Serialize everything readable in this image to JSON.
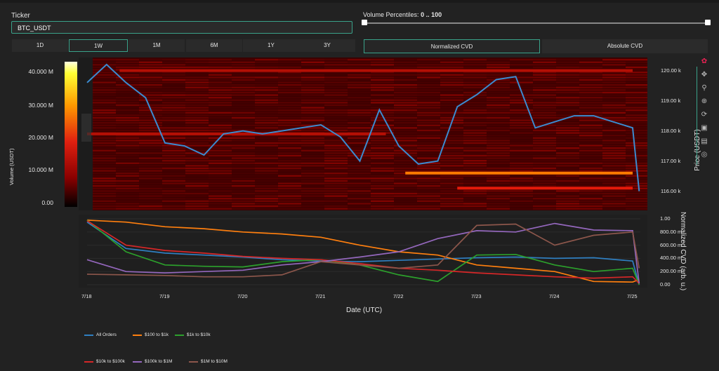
{
  "ticker": {
    "label": "Ticker",
    "value": "BTC_USDT"
  },
  "volume_percentiles": {
    "label": "Volume Percentiles:",
    "value": "0 .. 100",
    "range": [
      0,
      100
    ]
  },
  "timeframes": [
    {
      "label": "1D",
      "active": false
    },
    {
      "label": "1W",
      "active": true
    },
    {
      "label": "1M",
      "active": false
    },
    {
      "label": "6M",
      "active": false
    },
    {
      "label": "1Y",
      "active": false
    },
    {
      "label": "3Y",
      "active": false
    }
  ],
  "modes": {
    "normalized": "Normalized CVD",
    "absolute": "Absolute CVD",
    "active": "normalized"
  },
  "colorbar": {
    "title": "Volume (USDT)",
    "ticks": [
      "40.000 M",
      "30.000 M",
      "20.000 M",
      "10.000 M",
      "0.00"
    ]
  },
  "price_axis": {
    "title": "Price (USDT)",
    "ticks": [
      "120.00 k",
      "119.00 k",
      "118.00 k",
      "117.00 k",
      "116.00 k"
    ]
  },
  "cvd_axis": {
    "title": "Normalized CVD (arb. u.)",
    "ticks": [
      "1.00",
      "800.00 m",
      "600.00 m",
      "400.00 m",
      "200.00 m",
      "0.00"
    ]
  },
  "x_axis": {
    "title": "Date (UTC)",
    "ticks": [
      "7/18",
      "7/19",
      "7/20",
      "7/21",
      "7/22",
      "7/23",
      "7/24",
      "7/25"
    ]
  },
  "legend": [
    {
      "label": "All Orders",
      "color": "#2f7fc1"
    },
    {
      "label": "$100 to $1k",
      "color": "#ff7f0e"
    },
    {
      "label": "$1k to $10k",
      "color": "#2ca02c"
    },
    {
      "label": "$10k to $100k",
      "color": "#d62728"
    },
    {
      "label": "$100k to $1M",
      "color": "#9467bd"
    },
    {
      "label": "$1M to $10M",
      "color": "#8c564b"
    }
  ],
  "toolbar": [
    "plotly-logo-icon",
    "pan-icon",
    "zoom-icon",
    "zoom-in-icon",
    "reset-icon",
    "download-icon",
    "comment-icon",
    "autoscale-icon"
  ],
  "chart_data": [
    {
      "type": "heatmap",
      "title": "",
      "xlabel": "Date (UTC)",
      "ylabel": "Price (USDT)",
      "ylim": [
        115800,
        120400
      ],
      "heat_bands": [
        {
          "price": 120000,
          "start": "7/18 10:00",
          "end": "7/25 00:00",
          "volume_M": 9
        },
        {
          "price": 116600,
          "start": "7/22 02:00",
          "end": "7/25 00:00",
          "volume_M": 30
        },
        {
          "price": 116100,
          "start": "7/22 18:00",
          "end": "7/25 00:00",
          "volume_M": 14
        },
        {
          "price": 117900,
          "start": "7/18 00:00",
          "end": "7/21 20:00",
          "volume_M": 7
        }
      ],
      "price_line": {
        "name": "",
        "color": "#3b8bd0",
        "x": [
          "7/18 00:00",
          "7/18 06:00",
          "7/18 12:00",
          "7/18 18:00",
          "7/19 00:00",
          "7/19 06:00",
          "7/19 12:00",
          "7/19 18:00",
          "7/20 00:00",
          "7/20 06:00",
          "7/20 12:00",
          "7/20 18:00",
          "7/21 00:00",
          "7/21 06:00",
          "7/21 12:00",
          "7/21 18:00",
          "7/22 00:00",
          "7/22 06:00",
          "7/22 12:00",
          "7/22 18:00",
          "7/23 00:00",
          "7/23 06:00",
          "7/23 12:00",
          "7/23 18:00",
          "7/24 00:00",
          "7/24 06:00",
          "7/24 12:00",
          "7/24 18:00",
          "7/25 00:00",
          "7/25 02:00"
        ],
        "y": [
          119600,
          120200,
          119600,
          119100,
          117600,
          117500,
          117200,
          117900,
          118000,
          117900,
          118000,
          118100,
          118200,
          117800,
          117000,
          118700,
          117500,
          116900,
          117000,
          118800,
          119200,
          119700,
          119800,
          118100,
          118300,
          118500,
          118500,
          118300,
          118100,
          116000
        ]
      }
    },
    {
      "type": "line",
      "title": "",
      "xlabel": "Date (UTC)",
      "ylabel": "Normalized CVD (arb. u.)",
      "ylim": [
        0,
        1
      ],
      "x": [
        "7/18 00:00",
        "7/18 12:00",
        "7/19 00:00",
        "7/19 12:00",
        "7/20 00:00",
        "7/20 12:00",
        "7/21 00:00",
        "7/21 12:00",
        "7/22 00:00",
        "7/22 12:00",
        "7/23 00:00",
        "7/23 12:00",
        "7/24 00:00",
        "7/24 12:00",
        "7/25 00:00",
        "7/25 02:00"
      ],
      "series": [
        {
          "name": "All Orders",
          "color": "#2f7fc1",
          "values": [
            0.95,
            0.55,
            0.48,
            0.45,
            0.42,
            0.38,
            0.36,
            0.35,
            0.37,
            0.39,
            0.41,
            0.42,
            0.4,
            0.41,
            0.36,
            0.0
          ]
        },
        {
          "name": "$100 to $1k",
          "color": "#ff7f0e",
          "values": [
            0.98,
            0.95,
            0.88,
            0.85,
            0.8,
            0.77,
            0.72,
            0.6,
            0.5,
            0.45,
            0.3,
            0.25,
            0.2,
            0.05,
            0.04,
            0.08
          ]
        },
        {
          "name": "$1k to $10k",
          "color": "#2ca02c",
          "values": [
            0.98,
            0.5,
            0.3,
            0.28,
            0.27,
            0.35,
            0.38,
            0.3,
            0.15,
            0.05,
            0.45,
            0.46,
            0.3,
            0.2,
            0.25,
            0.0
          ]
        },
        {
          "name": "$10k to $100k",
          "color": "#d62728",
          "values": [
            0.97,
            0.6,
            0.52,
            0.48,
            0.43,
            0.4,
            0.38,
            0.32,
            0.25,
            0.22,
            0.18,
            0.15,
            0.12,
            0.1,
            0.12,
            0.02
          ]
        },
        {
          "name": "$100k to $1M",
          "color": "#9467bd",
          "values": [
            0.38,
            0.2,
            0.18,
            0.2,
            0.22,
            0.3,
            0.35,
            0.42,
            0.5,
            0.7,
            0.82,
            0.8,
            0.93,
            0.83,
            0.82,
            0.02
          ]
        },
        {
          "name": "$1M to $10M",
          "color": "#8c564b",
          "values": [
            0.16,
            0.15,
            0.14,
            0.12,
            0.12,
            0.15,
            0.35,
            0.3,
            0.25,
            0.3,
            0.9,
            0.92,
            0.6,
            0.75,
            0.8,
            0.25
          ]
        }
      ]
    }
  ]
}
